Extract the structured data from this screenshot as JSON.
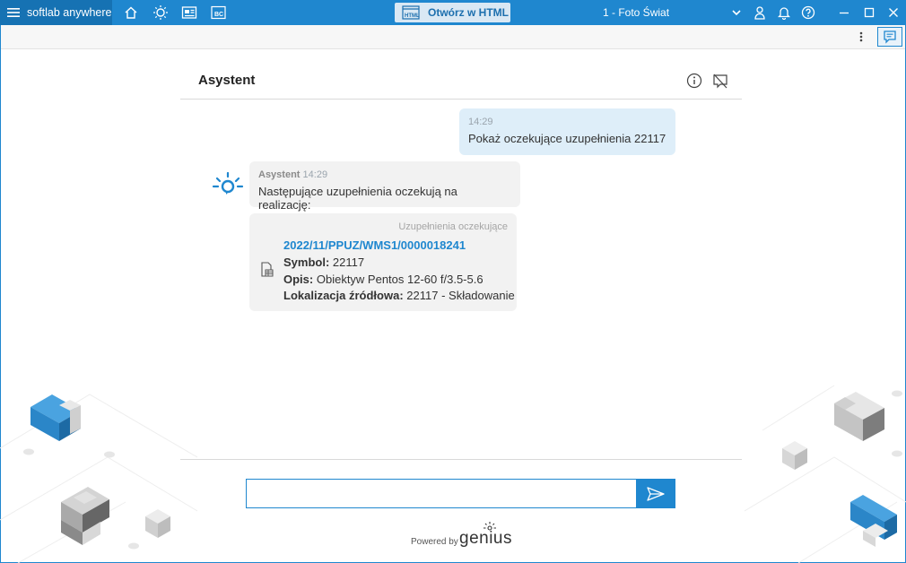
{
  "titlebar": {
    "brand": "softlab anywhere",
    "html_button_label": "Otwórz w HTML",
    "html_badge": "HTML",
    "bc_badge": "BC",
    "company": "1 - Foto Świat",
    "icons": [
      "menu-icon",
      "home-icon",
      "lightbulb-icon",
      "news-icon",
      "bc-icon",
      "chevron-down-icon",
      "user-icon",
      "bell-icon",
      "help-icon",
      "minimize-icon",
      "maximize-icon",
      "close-icon"
    ]
  },
  "panel": {
    "title": "Asystent"
  },
  "messages": {
    "user": {
      "time": "14:29",
      "text": "Pokaż oczekujące uzupełnienia 22117"
    },
    "bot": {
      "sender": "Asystent",
      "time": "14:29",
      "text": "Następujące uzupełnienia oczekują na realizację:"
    }
  },
  "card": {
    "header": "Uzupełnienia oczekujące",
    "link": "2022/11/PPUZ/WMS1/0000018241",
    "symbol_label": "Symbol:",
    "symbol_value": "22117",
    "opis_label": "Opis:",
    "opis_value": "Obiektyw Pentos 12-60 f/3.5-5.6",
    "lok_label": "Lokalizacja źródłowa:",
    "lok_value": "22117 - Składowanie"
  },
  "input": {
    "value": ""
  },
  "footer": {
    "powered_by": "Powered by",
    "brand": "genius"
  },
  "colors": {
    "accent": "#1f87cf",
    "titlebar_dark": "#1672b3",
    "user_bubble": "#deeef9",
    "bot_bubble": "#f2f2f2"
  }
}
